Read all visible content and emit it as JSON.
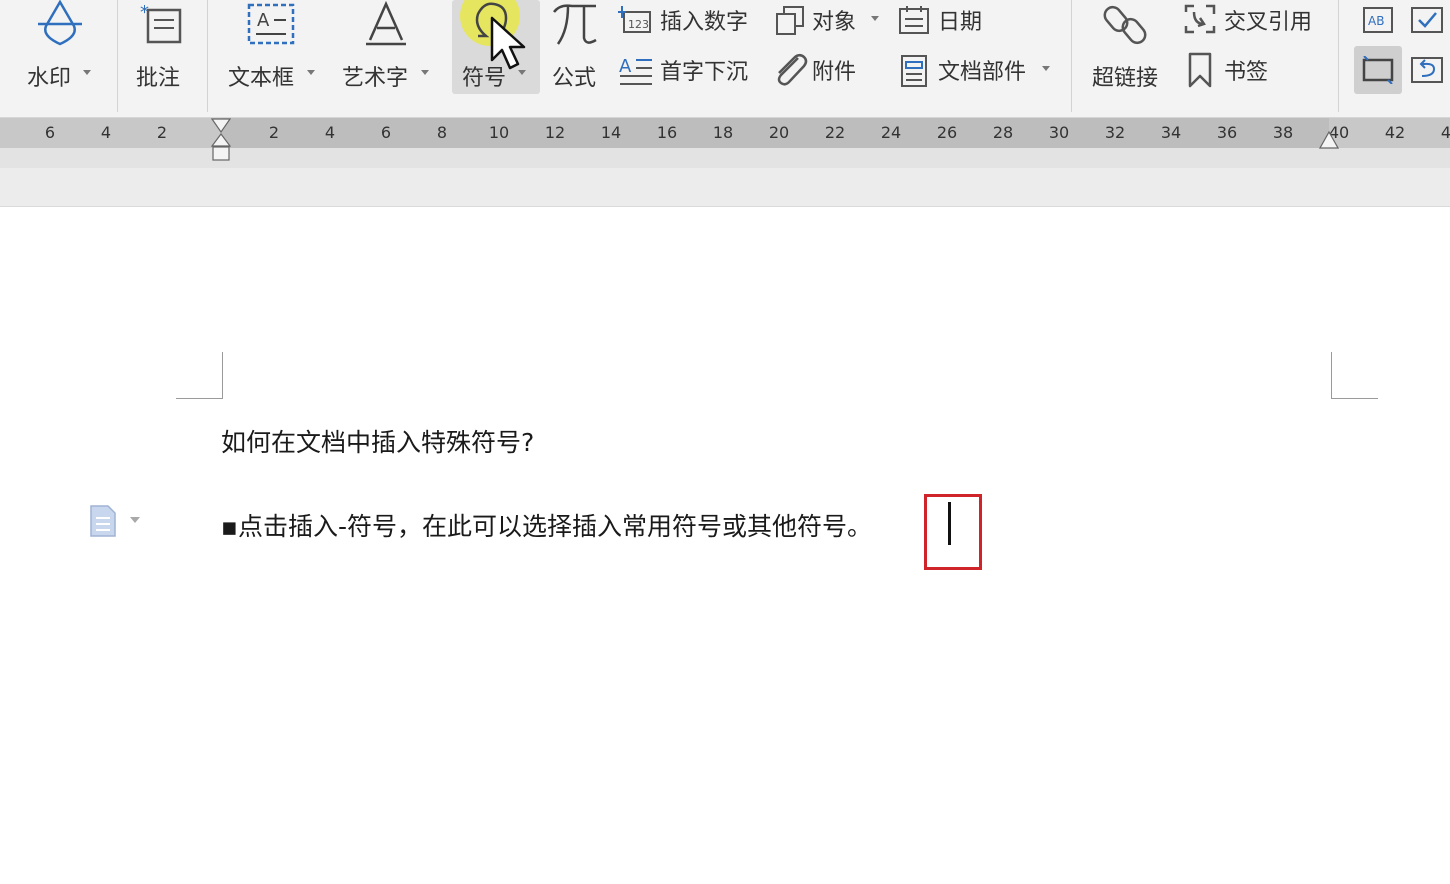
{
  "ribbon": {
    "watermark": "水印",
    "comment": "批注",
    "textbox": "文本框",
    "wordart": "艺术字",
    "symbol": "符号",
    "formula": "公式",
    "insert_number": "插入数字",
    "dropcap": "首字下沉",
    "object": "对象",
    "attachment": "附件",
    "date": "日期",
    "doc_parts": "文档部件",
    "hyperlink": "超链接",
    "cross_ref": "交叉引用",
    "bookmark": "书签",
    "number_icon_text": "123",
    "ab_icon_text": "AB"
  },
  "ruler": {
    "left_ticks": [
      "6",
      "4",
      "2"
    ],
    "right_ticks": [
      "2",
      "4",
      "6",
      "8",
      "10",
      "12",
      "14",
      "16",
      "18",
      "20",
      "22",
      "24",
      "26",
      "28",
      "30",
      "32",
      "34",
      "36",
      "38",
      "40",
      "42",
      "4"
    ]
  },
  "document": {
    "heading": "如何在文档中插入特殊符号?",
    "bullet_line": "▪点击插入-符号，在此可以选择插入常用符号或其他符号。"
  },
  "colors": {
    "accent": "#2f6fbd",
    "highlight": "#d0242b",
    "cursor_halo": "#e8e64a"
  }
}
